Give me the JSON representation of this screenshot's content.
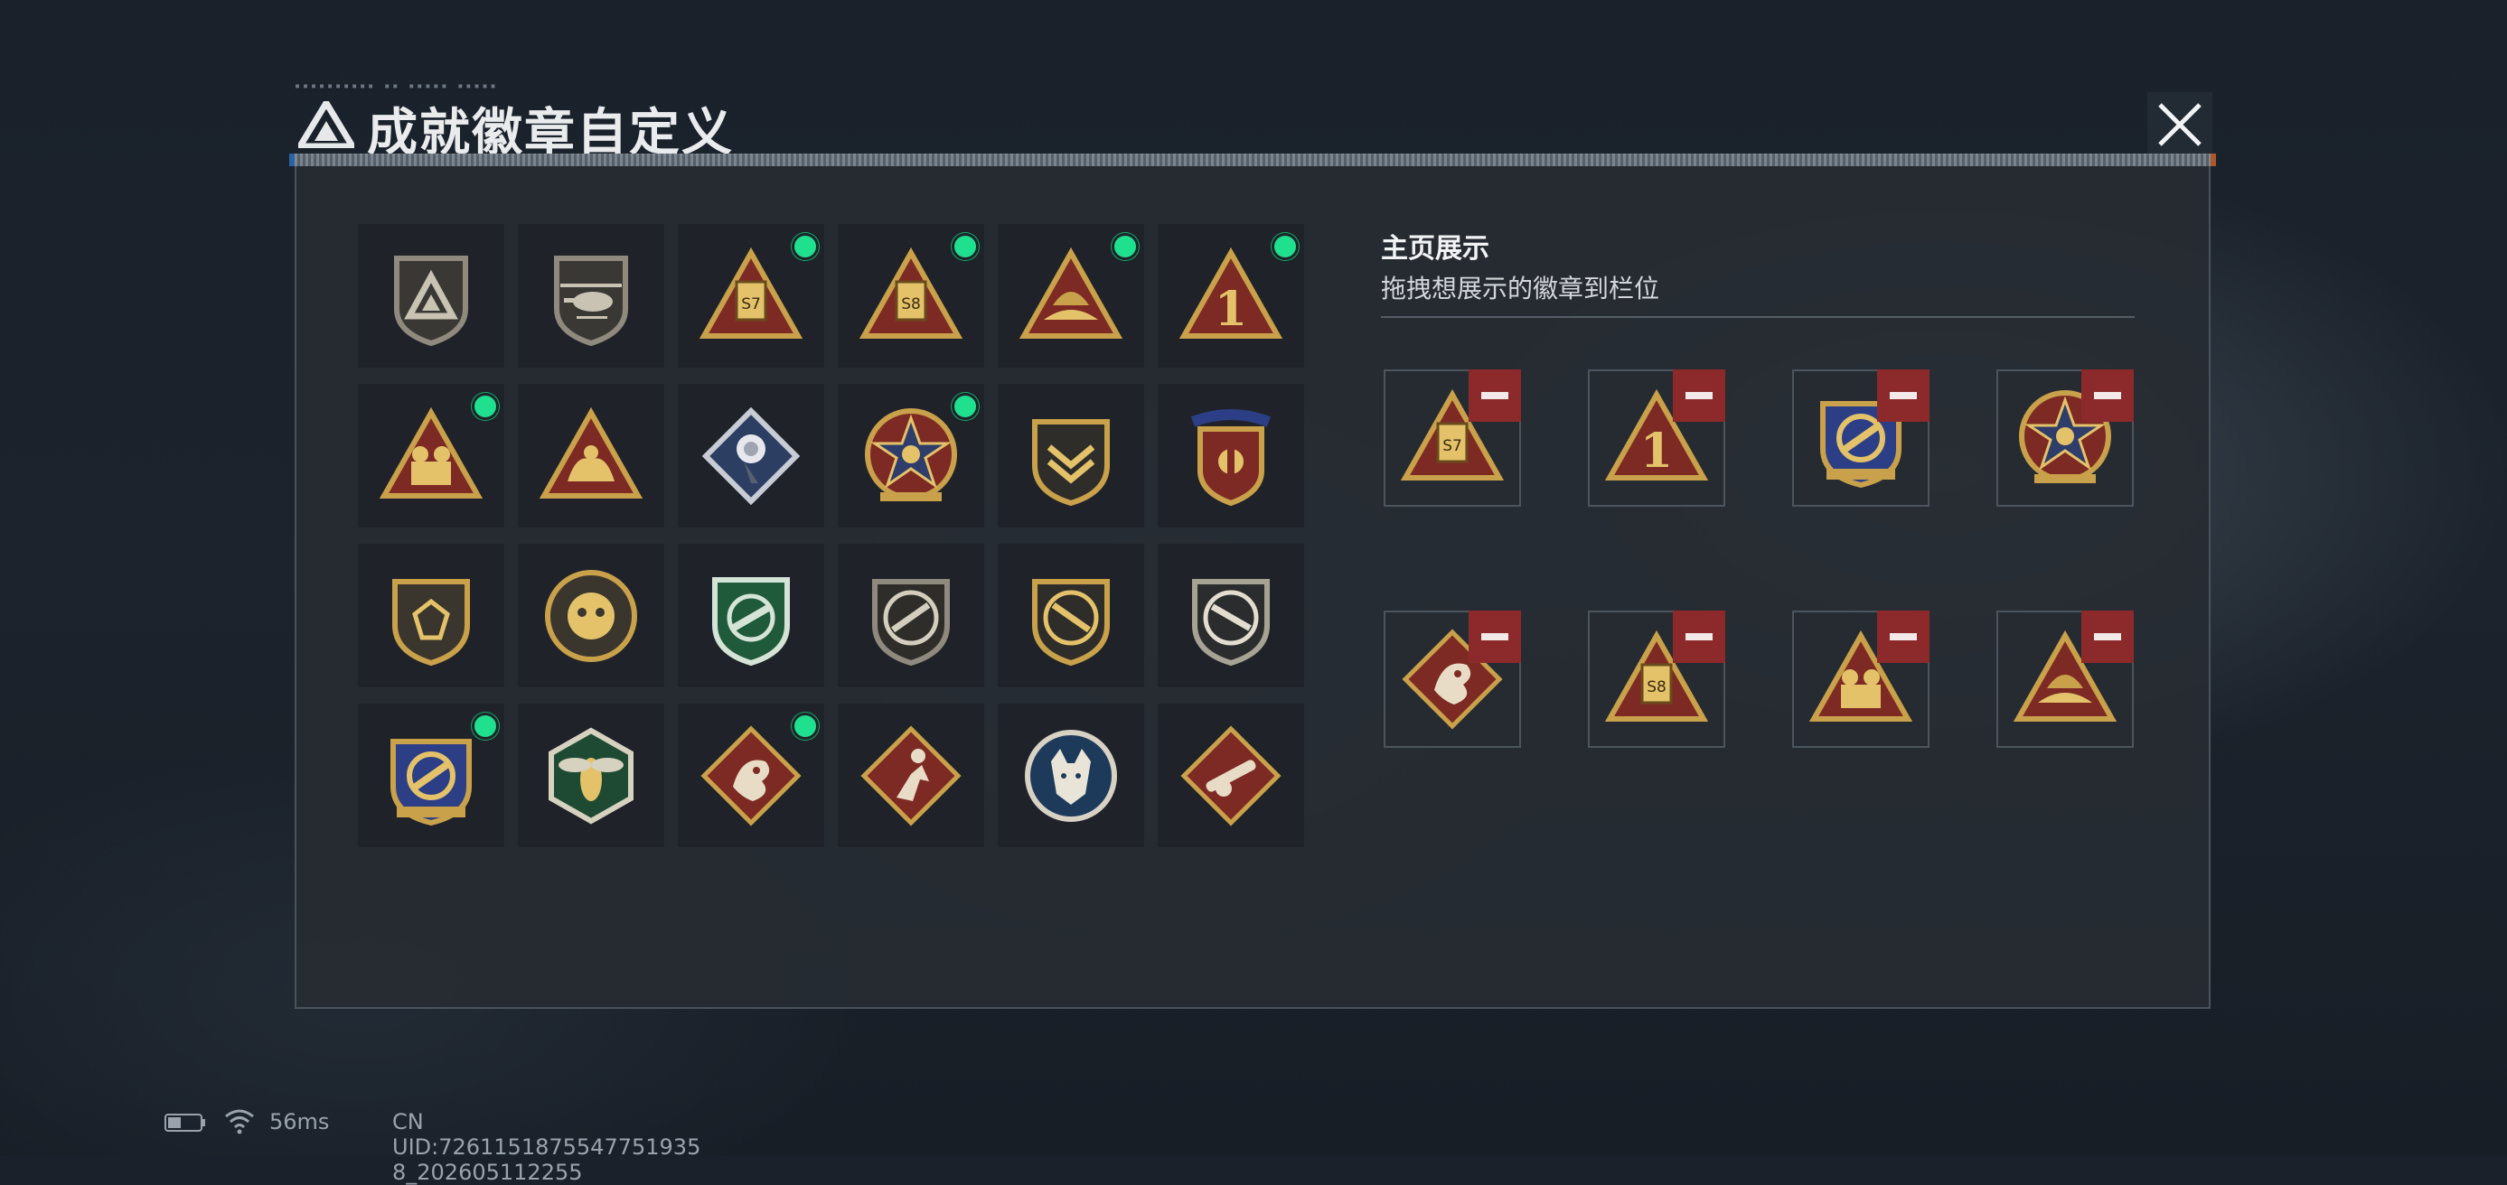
{
  "dialog": {
    "title": "成就徽章自定义",
    "title_ticks": "▪▪▪▪▪▪▪▪▪▪ ▪▪ ▪▪▪▪▪ ▪▪▪▪▪",
    "close_icon": "close-icon"
  },
  "display_section": {
    "title": "主页展示",
    "subtitle": "拖拽想展示的徽章到栏位"
  },
  "badge_grid": [
    {
      "icon": "delta-shield-badge",
      "is_new": false
    },
    {
      "icon": "helicopter-shield-badge",
      "is_new": false
    },
    {
      "icon": "s7-triangle-badge",
      "is_new": true
    },
    {
      "icon": "s8-triangle-badge",
      "is_new": true
    },
    {
      "icon": "rising-triangle-badge",
      "is_new": true
    },
    {
      "icon": "number-one-triangle-badge",
      "is_new": true
    },
    {
      "icon": "squad-triangle-badge",
      "is_new": true
    },
    {
      "icon": "hands-triangle-badge",
      "is_new": false
    },
    {
      "icon": "rose-diamond-badge",
      "is_new": false
    },
    {
      "icon": "skull-star-badge",
      "is_new": true
    },
    {
      "icon": "chevron-shield-badge",
      "is_new": false
    },
    {
      "icon": "winged-shield-badge",
      "is_new": false
    },
    {
      "icon": "gem-shield-badge",
      "is_new": false
    },
    {
      "icon": "scarab-round-badge",
      "is_new": false
    },
    {
      "icon": "rifle-green-shield-badge",
      "is_new": false
    },
    {
      "icon": "rifle-round-shield-badge",
      "is_new": false
    },
    {
      "icon": "rifle-shield-badge",
      "is_new": false
    },
    {
      "icon": "rifle-dark-shield-badge",
      "is_new": false
    },
    {
      "icon": "crosshair-shield-badge",
      "is_new": true
    },
    {
      "icon": "wasp-hexagon-badge",
      "is_new": false
    },
    {
      "icon": "dragon-diamond-badge",
      "is_new": true
    },
    {
      "icon": "runner-diamond-badge",
      "is_new": false
    },
    {
      "icon": "wolf-round-badge",
      "is_new": false
    },
    {
      "icon": "cannon-diamond-badge",
      "is_new": false
    }
  ],
  "display_slots": [
    {
      "icon": "s7-triangle-badge",
      "remove_icon": "minus-icon"
    },
    {
      "icon": "number-one-triangle-badge",
      "remove_icon": "minus-icon"
    },
    {
      "icon": "crosshair-shield-badge",
      "remove_icon": "minus-icon"
    },
    {
      "icon": "skull-star-badge",
      "remove_icon": "minus-icon"
    },
    {
      "icon": "dragon-diamond-badge",
      "remove_icon": "minus-icon"
    },
    {
      "icon": "s8-triangle-badge",
      "remove_icon": "minus-icon"
    },
    {
      "icon": "squad-triangle-badge",
      "remove_icon": "minus-icon"
    },
    {
      "icon": "rising-triangle-badge",
      "remove_icon": "minus-icon"
    }
  ],
  "status_bar": {
    "battery_icon": "battery-icon",
    "wifi_icon": "wifi-icon",
    "ping": "56ms",
    "uid": "CN UID:7261151875547751935 8_202605112255"
  },
  "colors": {
    "accent_green": "#1fe08f",
    "remove_red": "#8c2a2b",
    "badge_gold": "#c9a14a",
    "badge_red": "#7e2a24"
  }
}
